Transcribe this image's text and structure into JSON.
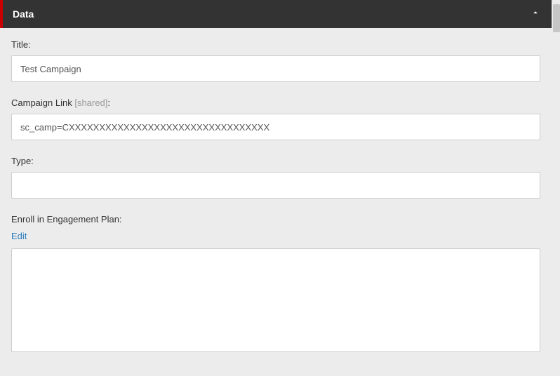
{
  "panel": {
    "header": {
      "title": "Data",
      "collapse_icon": "chevron-up"
    },
    "fields": {
      "title": {
        "label": "Title:",
        "value": "Test Campaign"
      },
      "campaign_link": {
        "label": "Campaign Link ",
        "shared_text": "[shared]",
        "suffix": ":",
        "value": "sc_camp=CXXXXXXXXXXXXXXXXXXXXXXXXXXXXXXXXX"
      },
      "type": {
        "label": "Type:",
        "value": ""
      },
      "engagement": {
        "label": "Enroll in Engagement Plan:",
        "edit_link": "Edit"
      }
    }
  }
}
